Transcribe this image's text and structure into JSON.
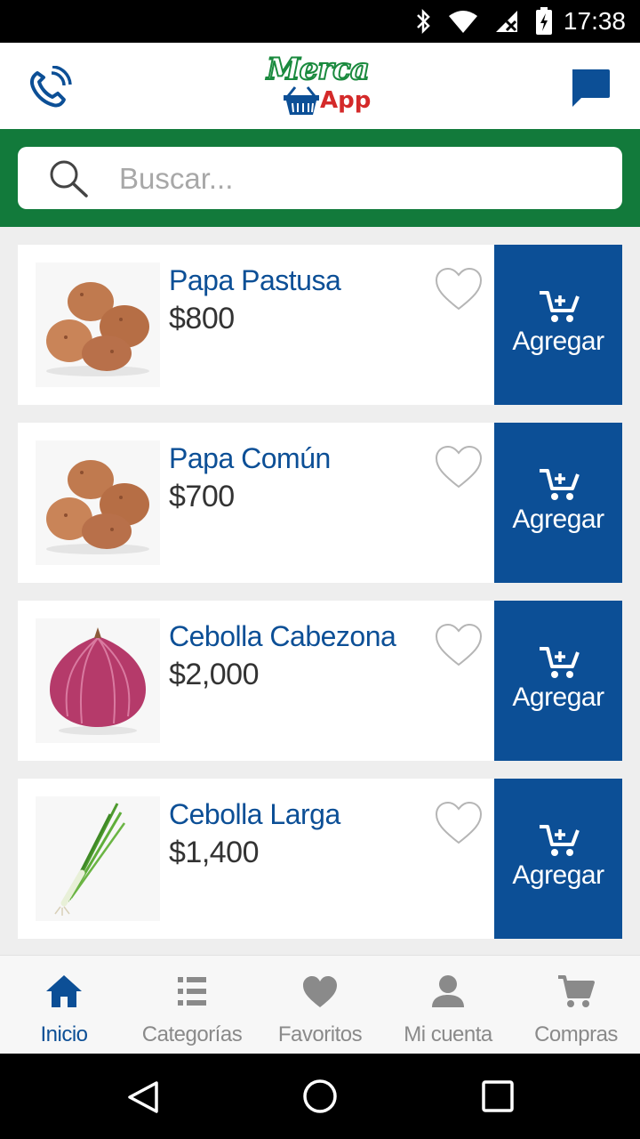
{
  "status_bar": {
    "time": "17:38"
  },
  "header": {
    "logo_top": "Merca",
    "logo_bottom": "App"
  },
  "search": {
    "placeholder": "Buscar..."
  },
  "products": [
    {
      "name": "Papa Pastusa",
      "price": "$800",
      "add_label": "Agregar",
      "image": "potatoes"
    },
    {
      "name": "Papa Común",
      "price": "$700",
      "add_label": "Agregar",
      "image": "potatoes"
    },
    {
      "name": "Cebolla Cabezona",
      "price": "$2,000",
      "add_label": "Agregar",
      "image": "red-onion"
    },
    {
      "name": "Cebolla Larga",
      "price": "$1,400",
      "add_label": "Agregar",
      "image": "green-onion"
    }
  ],
  "bottom_nav": [
    {
      "label": "Inicio",
      "icon": "home-icon",
      "active": true
    },
    {
      "label": "Categorías",
      "icon": "list-icon",
      "active": false
    },
    {
      "label": "Favoritos",
      "icon": "heart-icon",
      "active": false
    },
    {
      "label": "Mi cuenta",
      "icon": "user-icon",
      "active": false
    },
    {
      "label": "Compras",
      "icon": "cart-icon",
      "active": false
    }
  ],
  "colors": {
    "primary_blue": "#0c4f96",
    "brand_green": "#127a3b",
    "logo_red": "#d42a2a",
    "inactive_gray": "#8a8a8a"
  }
}
